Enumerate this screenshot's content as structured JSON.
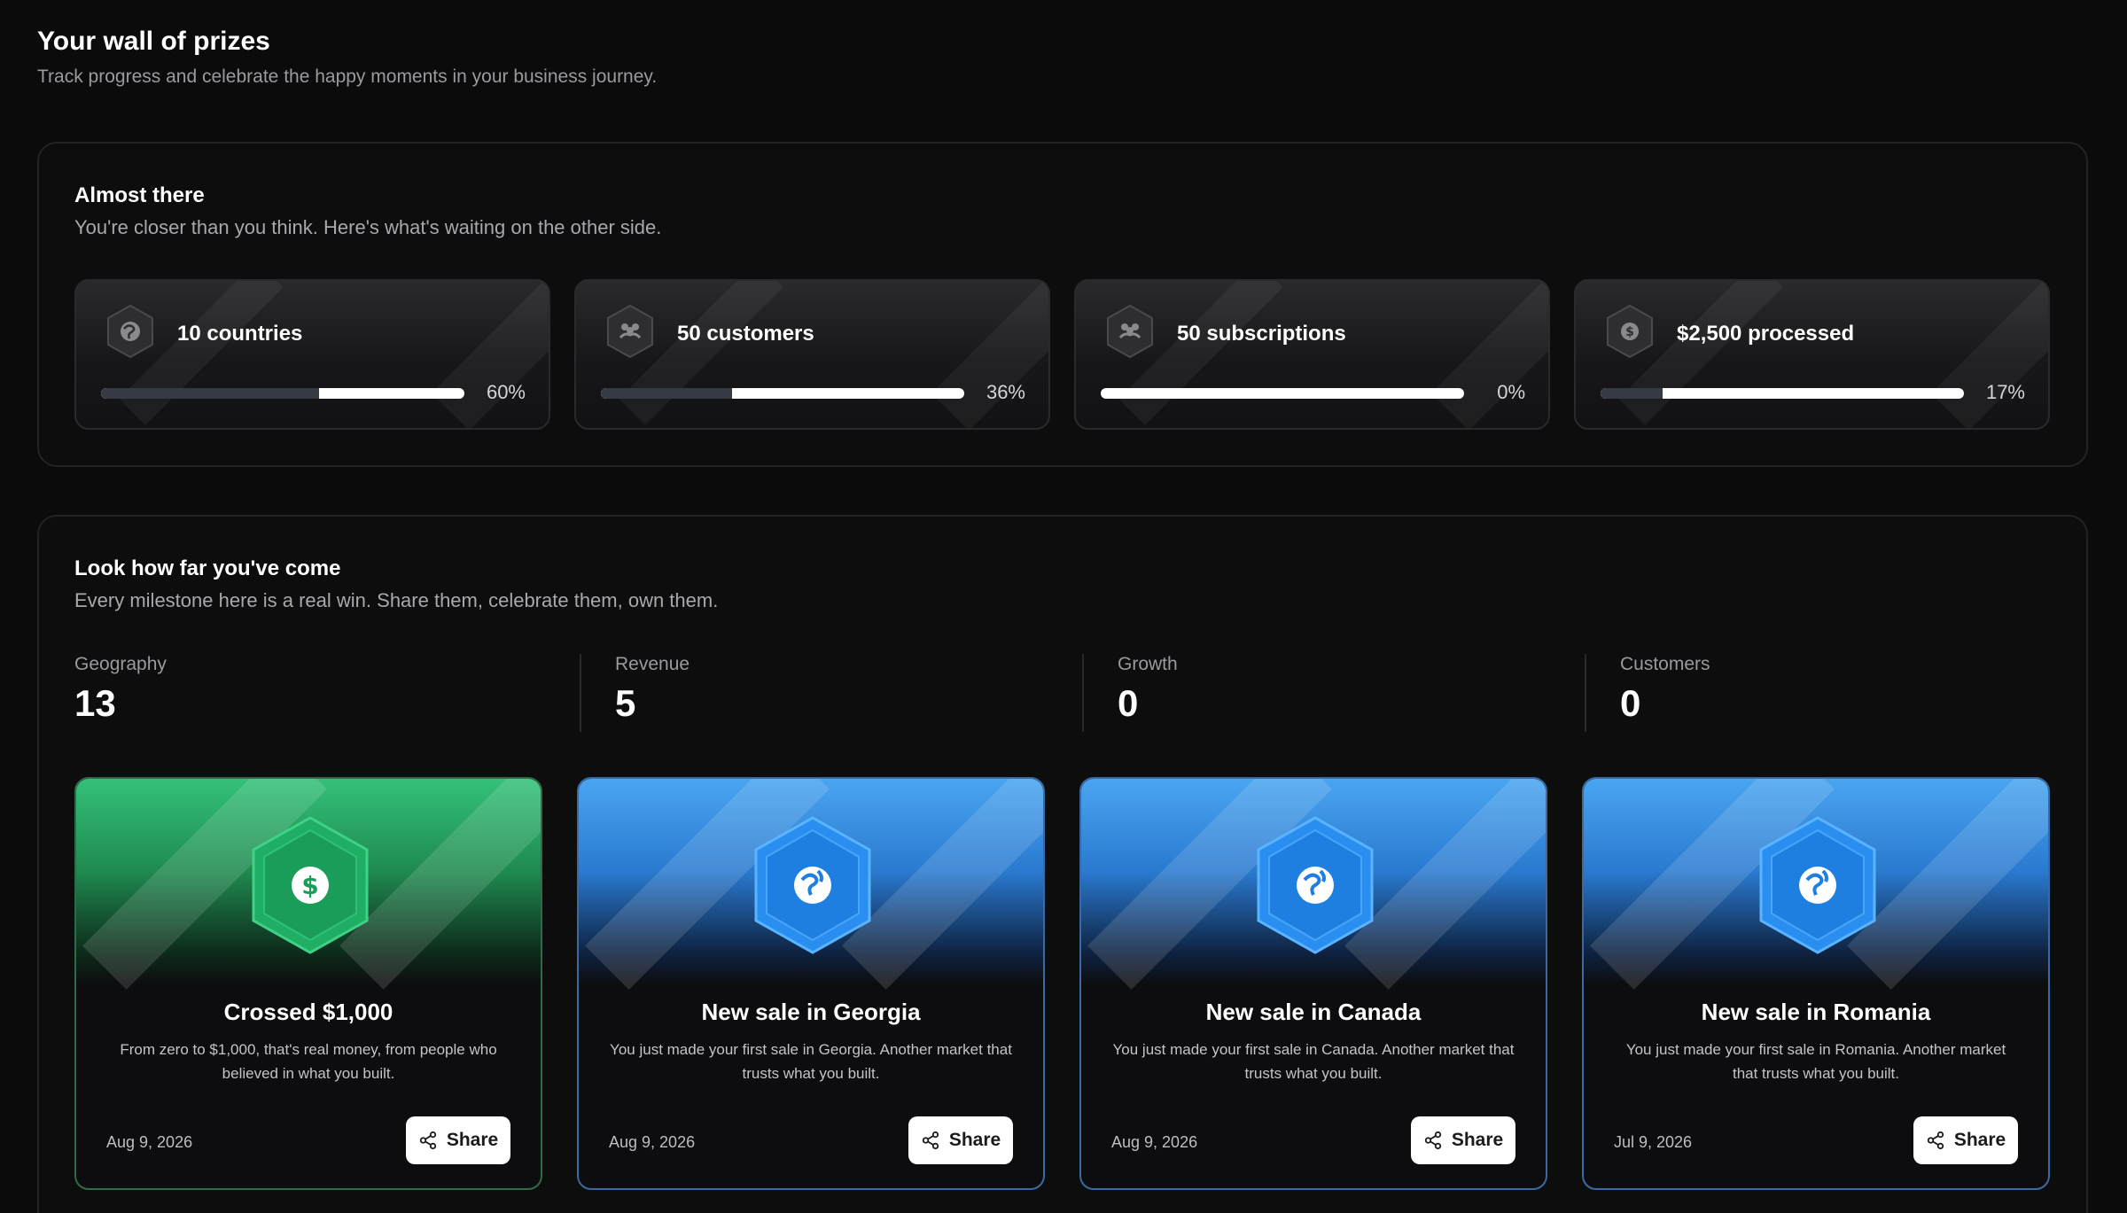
{
  "header": {
    "title": "Your wall of prizes",
    "subtitle": "Track progress and celebrate the happy moments in your business journey."
  },
  "almost_there": {
    "title": "Almost there",
    "subtitle": "You're closer than you think. Here's what's waiting on the other side.",
    "items": [
      {
        "label": "10 countries",
        "percent_text": "60%",
        "progress": 0.6,
        "icon": "globe-icon"
      },
      {
        "label": "50 customers",
        "percent_text": "36%",
        "progress": 0.36,
        "icon": "users-icon"
      },
      {
        "label": "50 subscriptions",
        "percent_text": "0%",
        "progress": 0,
        "icon": "users-icon"
      },
      {
        "label": "$2,500 processed",
        "percent_text": "17%",
        "progress": 0.17,
        "icon": "dollar-icon"
      }
    ]
  },
  "far": {
    "title": "Look how far you've come",
    "subtitle": "Every milestone here is a real win. Share them, celebrate them, own them.",
    "stats": [
      {
        "label": "Geography",
        "value": "13"
      },
      {
        "label": "Revenue",
        "value": "5"
      },
      {
        "label": "Growth",
        "value": "0"
      },
      {
        "label": "Customers",
        "value": "0"
      }
    ],
    "prizes": [
      {
        "title": "Crossed $1,000",
        "description": "From zero to $1,000, that's real money, from people who believed in what you built.",
        "date": "Aug 9, 2026",
        "share_label": "Share",
        "theme": "green",
        "icon": "dollar-icon"
      },
      {
        "title": "New sale in Georgia",
        "description": "You just made your first sale in Georgia. Another market that trusts what you built.",
        "date": "Aug 9, 2026",
        "share_label": "Share",
        "theme": "blue",
        "icon": "globe-icon"
      },
      {
        "title": "New sale in Canada",
        "description": "You just made your first sale in Canada. Another market that trusts what you built.",
        "date": "Aug 9, 2026",
        "share_label": "Share",
        "theme": "blue",
        "icon": "globe-icon"
      },
      {
        "title": "New sale in Romania",
        "description": "You just made your first sale in Romania. Another market that trusts what you built.",
        "date": "Jul 9, 2026",
        "share_label": "Share",
        "theme": "blue",
        "icon": "globe-icon"
      }
    ]
  },
  "colors": {
    "background": "#0b0b0c",
    "green_badge": "#1fae63",
    "blue_badge": "#2a8ef0",
    "progress_fill": "#363a44",
    "progress_track": "#ffffff"
  }
}
